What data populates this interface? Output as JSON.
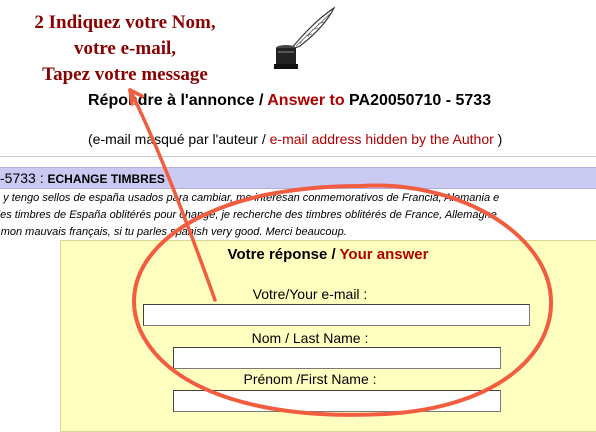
{
  "instruction": {
    "line1": "2 Indiquez votre Nom,",
    "line2": "votre e-mail,",
    "line3": "Tapez votre message"
  },
  "header": {
    "reply_fr": "Répondre à l'annonce / ",
    "reply_en": "Answer to",
    "ad_ref": "PA20050710 - 5733",
    "hidden_fr": "(e-mail masqué par l'auteur / ",
    "hidden_en": "e-mail address hidden by the Author",
    "hidden_close": " )"
  },
  "ad": {
    "id_fragment": "-5733 : ",
    "title": "ECHANGE TIMBRES",
    "message_lines": [
      "a y tengo sellos de españa usados para cambiar, me interesan conmemorativos de Francia, Alemania e",
      "des timbres de España oblitérés pour change, je recherche des timbres oblitérés de France, Allemagne",
      "r mon mauvais français, si tu parles spanish very good. Merci beaucoup."
    ]
  },
  "form": {
    "title_fr": "Votre réponse / ",
    "title_en": "Your answer",
    "email_label": "Votre/Your e-mail :",
    "lastname_label": "Nom / Last Name :",
    "firstname_label": "Prénom /First Name :",
    "email_value": "",
    "lastname_value": "",
    "firstname_value": ""
  },
  "icons": {
    "inkwell": "inkwell-quill-icon"
  },
  "colors": {
    "annotation_red": "#8b0000",
    "accent_red": "#b00000",
    "title_bar": "#c9c9f2",
    "form_bg": "#ffffc0",
    "circle_red": "#f25c3f"
  }
}
